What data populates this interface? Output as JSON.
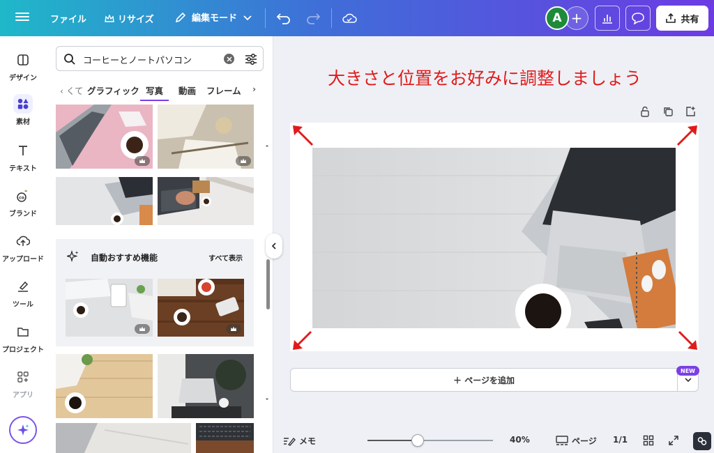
{
  "topbar": {
    "file_label": "ファイル",
    "resize_label": "リサイズ",
    "edit_mode_label": "編集モード",
    "avatar_letter": "A",
    "share_label": "共有"
  },
  "rail": {
    "items": [
      {
        "label": "デザイン",
        "icon": "layout-icon"
      },
      {
        "label": "素材",
        "icon": "shapes-icon"
      },
      {
        "label": "テキスト",
        "icon": "text-icon"
      },
      {
        "label": "ブランド",
        "icon": "brand-icon"
      },
      {
        "label": "アップロード",
        "icon": "upload-cloud-icon"
      },
      {
        "label": "ツール",
        "icon": "draw-icon"
      },
      {
        "label": "プロジェクト",
        "icon": "folder-icon"
      },
      {
        "label": "アプリ",
        "icon": "apps-icon"
      }
    ]
  },
  "panel": {
    "search_value": "コーヒーとノートパソコン",
    "tabs": [
      "くて",
      "グラフィック",
      "写真",
      "動画",
      "フレーム"
    ],
    "active_tab": "写真",
    "recommend_title": "自動おすすめ機能",
    "recommend_all": "すべて表示"
  },
  "canvas": {
    "annotation": "大きさと位置をお好みに調整しましょう",
    "add_page_label": "＋ ページを追加",
    "new_badge": "NEW"
  },
  "bottombar": {
    "memo_label": "メモ",
    "zoom_value": 40,
    "zoom_label": "40%",
    "pages_label": "ページ",
    "page_count": "1/1"
  },
  "colors": {
    "accent": "#7b3fe4",
    "annotation": "#e01b1b",
    "avatar": "#1f8b3a"
  }
}
